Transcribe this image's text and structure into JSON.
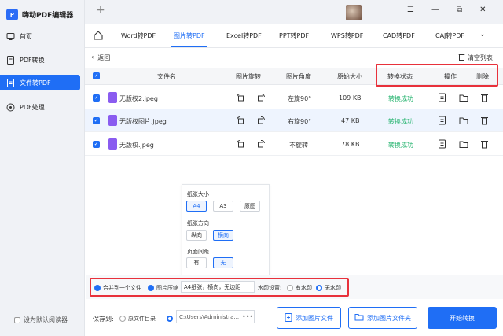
{
  "app": {
    "title": "嗨动PDF编辑器",
    "username": "."
  },
  "sidebar": {
    "items": [
      {
        "label": "首页",
        "icon": "monitor-icon"
      },
      {
        "label": "PDF转换",
        "icon": "pdf-convert-icon"
      },
      {
        "label": "文件转PDF",
        "icon": "file-to-pdf-icon",
        "active": true
      },
      {
        "label": "PDF处理",
        "icon": "pdf-process-icon"
      }
    ],
    "default_reader": "设为默认阅读器"
  },
  "tabs": [
    {
      "label": "Word转PDF"
    },
    {
      "label": "图片转PDF",
      "active": true
    },
    {
      "label": "Excel转PDF"
    },
    {
      "label": "PPT转PDF"
    },
    {
      "label": "WPS转PDF"
    },
    {
      "label": "CAD转PDF"
    },
    {
      "label": "CAJ转PDF"
    }
  ],
  "toolbar": {
    "back": "返回",
    "clear": "清空列表"
  },
  "table": {
    "headers": {
      "filename": "文件名",
      "rotate": "图片旋转",
      "angle": "图片角度",
      "size": "原始大小",
      "status": "转换状态",
      "ops": "操作",
      "delete": "删除"
    },
    "rows": [
      {
        "name": "无版权2.jpeg",
        "angle": "左旋90°",
        "size": "109 KB",
        "status": "转换成功"
      },
      {
        "name": "无版权图片.jpeg",
        "angle": "右旋90°",
        "size": "47 KB",
        "status": "转换成功"
      },
      {
        "name": "无版权.jpeg",
        "angle": "不旋转",
        "size": "78 KB",
        "status": "转换成功"
      }
    ]
  },
  "page_options": {
    "paper_size_label": "纸张大小",
    "paper_sizes": [
      "A4",
      "A3",
      "原图"
    ],
    "paper_size_selected": "A4",
    "orientation_label": "纸张方向",
    "orientations": [
      "纵向",
      "横向"
    ],
    "orientation_selected": "横向",
    "margin_label": "页面间距",
    "margins": [
      "有",
      "无"
    ],
    "margin_selected": "无"
  },
  "bottom_options": {
    "merge": "合并到一个文件",
    "compress": "图片压缩",
    "compress_value": "A4纸张，横向，无边距",
    "watermark_label": "水印设置:",
    "watermark_on": "有水印",
    "watermark_off": "无水印"
  },
  "footer": {
    "save_to": "保存到:",
    "source_dir": "原文件目录",
    "path": "C:\\Users\\Administra...",
    "path_more": "•••",
    "add_image": "添加图片文件",
    "add_folder": "添加图片文件夹",
    "start": "开始转换"
  },
  "colors": {
    "accent": "#1f6ef5",
    "success": "#2bb673",
    "highlight": "#e8313b"
  }
}
